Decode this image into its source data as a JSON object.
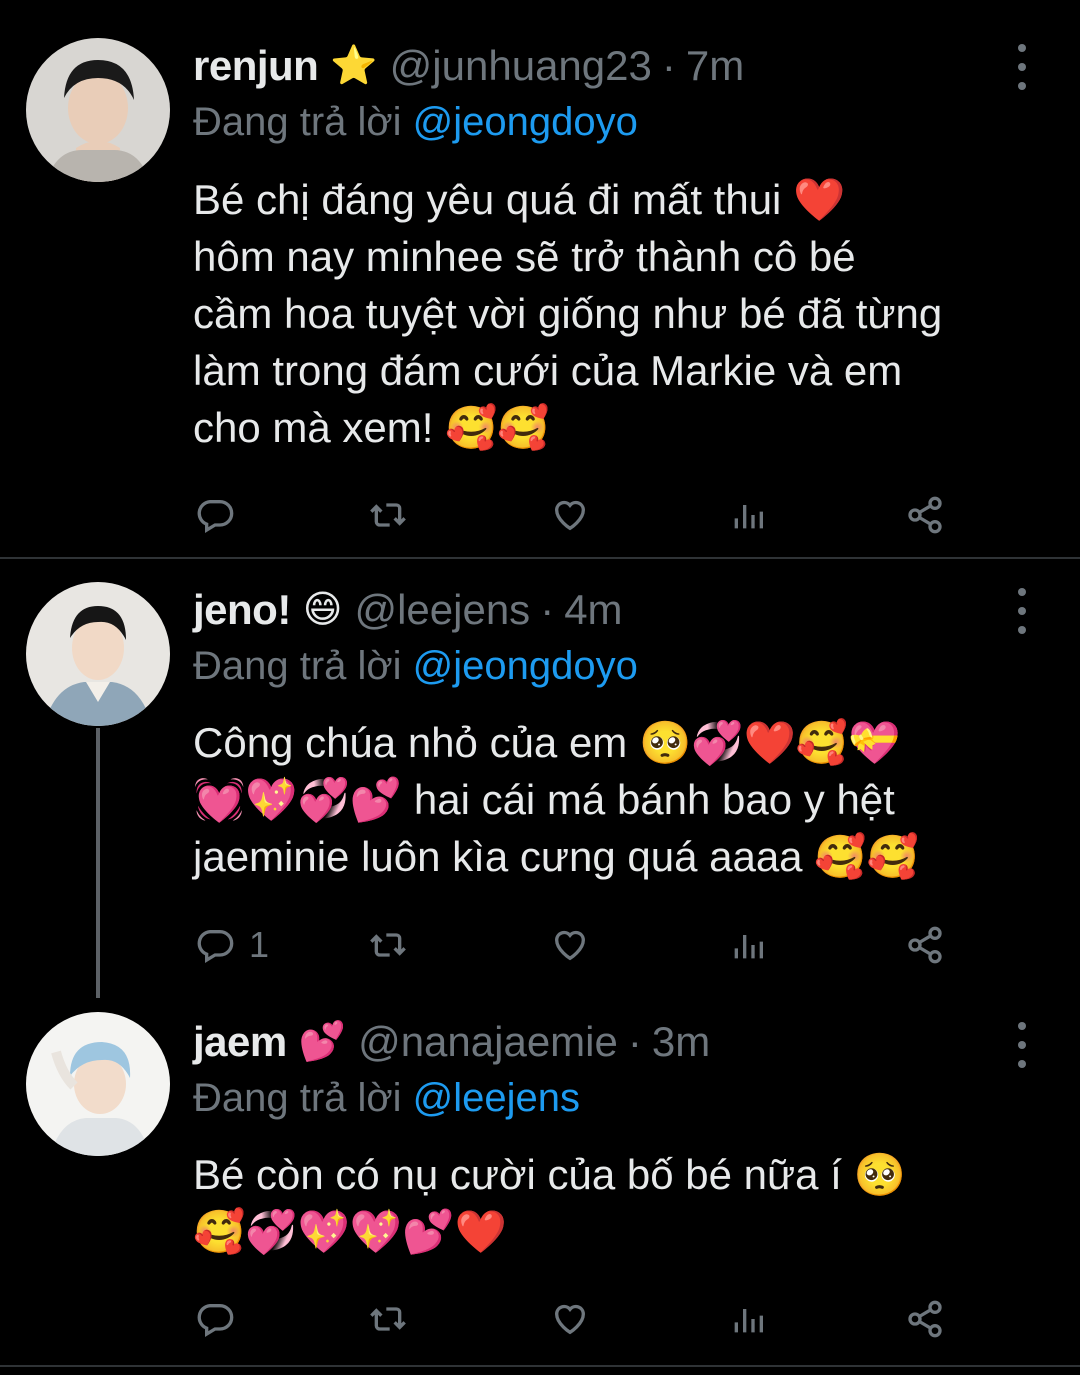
{
  "colors": {
    "background": "#000000",
    "text": "#e7e9ea",
    "muted": "#6e767d",
    "mention": "#1d9bf0",
    "heart": "#f91880"
  },
  "replying_prefix": "Đang trả lời",
  "tweets": [
    {
      "name": "renjun",
      "badge": "⭐",
      "handle": "@junhuang23",
      "time": "7m",
      "replying_to": "@jeongdoyo",
      "text": "Bé chị đáng yêu quá đi mất thui ❤️\nhôm nay minhee sẽ trở thành cô bé\ncầm hoa tuyệt vời giống như bé đã từng\nlàm trong đám cưới của Markie và em\ncho mà xem! 🥰🥰",
      "reply_count": "",
      "avatar_icon": "avatar-renjun"
    },
    {
      "name": "jeno!",
      "badge": "😄",
      "handle": "@leejens",
      "time": "4m",
      "replying_to": "@jeongdoyo",
      "text": "Công chúa nhỏ của em 🥺💞❤️🥰💝\n💓💖💞💕 hai cái má bánh bao y hệt\njaeminie luôn kìa cưng quá aaaa 🥰🥰",
      "reply_count": "1",
      "avatar_icon": "avatar-jeno"
    },
    {
      "name": "jaem",
      "badge": "💕",
      "handle": "@nanajaemie",
      "time": "3m",
      "replying_to": "@leejens",
      "text": "Bé còn có nụ cười của bố bé nữa í 🥺\n🥰💞💖💖💕❤️",
      "reply_count": "",
      "avatar_icon": "avatar-jaem"
    }
  ],
  "icons": {
    "reply": "reply-icon",
    "retweet": "retweet-icon",
    "like": "like-icon",
    "analytics": "analytics-icon",
    "share": "share-icon",
    "more": "more-icon"
  }
}
